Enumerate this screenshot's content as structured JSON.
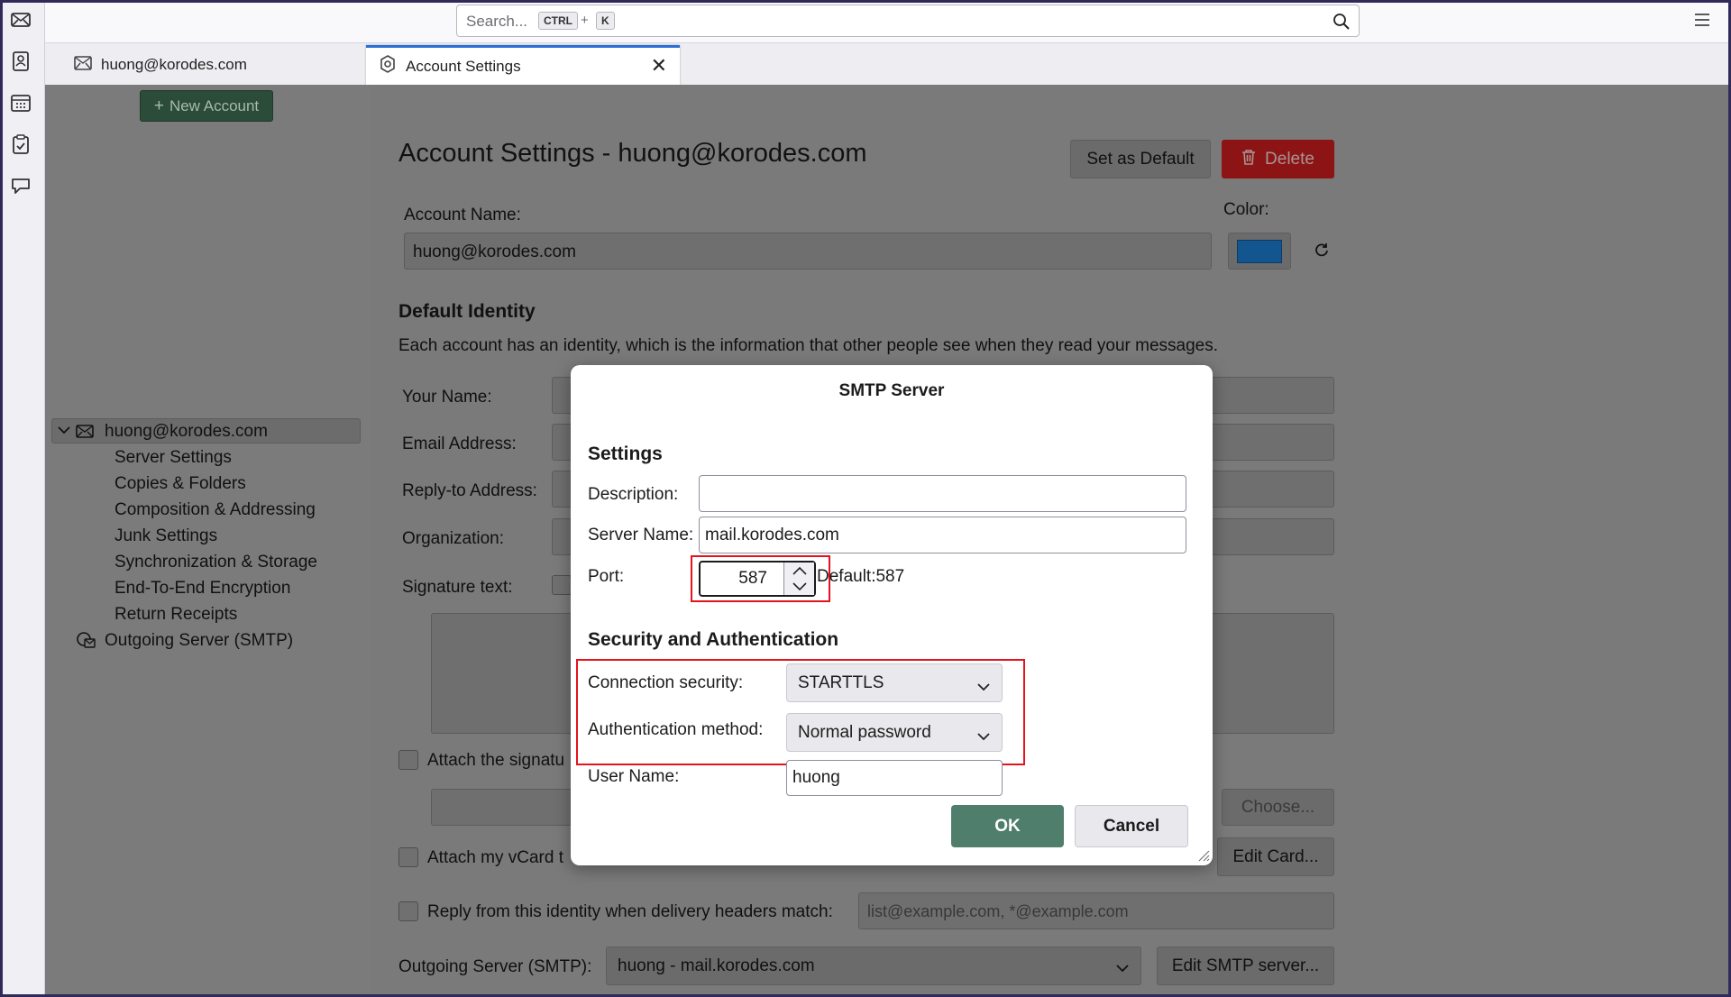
{
  "toolbar": {
    "search_placeholder": "Search...",
    "shortcut_ctrl": "CTRL",
    "shortcut_plus": "+",
    "shortcut_key": "K"
  },
  "spaces": [
    "mail-icon",
    "address-book-icon",
    "calendar-icon",
    "tasks-icon",
    "chat-icon"
  ],
  "tabs": [
    {
      "label": "huong@korodes.com",
      "icon": "mail-icon"
    },
    {
      "label": "Account Settings",
      "icon": "settings-icon",
      "close": "✕"
    }
  ],
  "left_pane": {
    "new_account": "New Account",
    "account": "huong@korodes.com",
    "items": [
      "Server Settings",
      "Copies & Folders",
      "Composition & Addressing",
      "Junk Settings",
      "Synchronization & Storage",
      "End-To-End Encryption",
      "Return Receipts"
    ],
    "outgoing": "Outgoing Server (SMTP)"
  },
  "main": {
    "title": "Account Settings - huong@korodes.com",
    "set_default": "Set as Default",
    "delete": "Delete",
    "account_name_label": "Account Name:",
    "account_name_value": "huong@korodes.com",
    "color_label": "Color:",
    "account_color": "#1f6fc0",
    "default_identity": "Default Identity",
    "identity_desc": "Each account has an identity, which is the information that other people see when they read your messages.",
    "your_name": "Your Name:",
    "email_address": "Email Address:",
    "reply_to": "Reply-to Address:",
    "organization": "Organization:",
    "signature_text": "Signature text:",
    "attach_signature": "Attach the signatu",
    "choose": "Choose...",
    "attach_vcard": "Attach my vCard t",
    "edit_card": "Edit Card...",
    "reply_from": "Reply from this identity when delivery headers match:",
    "reply_from_placeholder": "list@example.com, *@example.com",
    "outgoing_label": "Outgoing Server (SMTP):",
    "outgoing_value": "huong - mail.korodes.com",
    "edit_smtp": "Edit SMTP server..."
  },
  "dialog": {
    "title": "SMTP Server",
    "settings_heading": "Settings",
    "description_label": "Description:",
    "description_value": "",
    "server_name_label": "Server Name:",
    "server_name_value": "mail.korodes.com",
    "port_label": "Port:",
    "port_value": "587",
    "port_default": "Default:587",
    "security_heading": "Security and Authentication",
    "connection_security_label": "Connection security:",
    "connection_security_value": "STARTTLS",
    "auth_method_label": "Authentication method:",
    "auth_method_value": "Normal password",
    "user_name_label": "User Name:",
    "user_name_value": "huong",
    "ok": "OK",
    "cancel": "Cancel"
  },
  "colors": {
    "accent": "#2c6fd5",
    "ok_button": "#4f7e6d",
    "delete_button": "#8c1414",
    "highlight_box": "#e3141d"
  }
}
